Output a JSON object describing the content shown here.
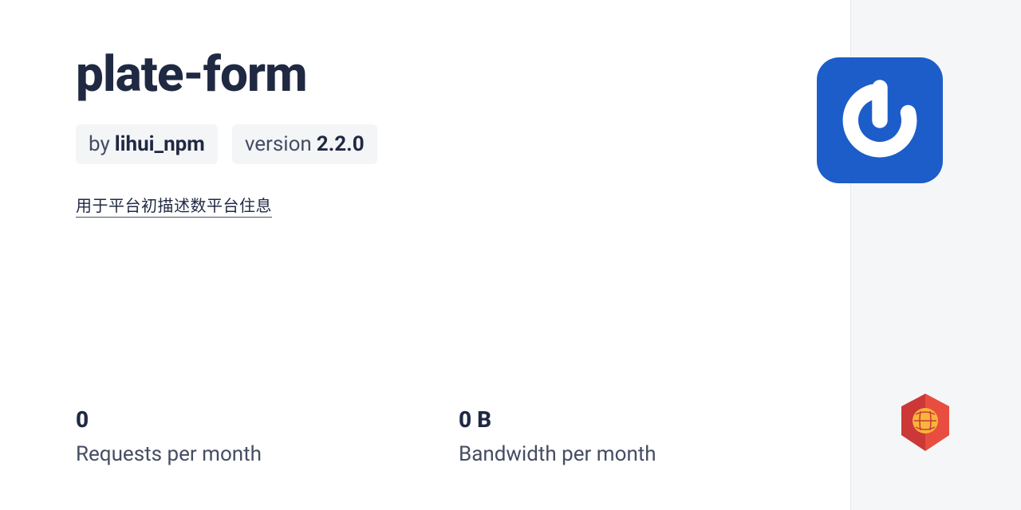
{
  "package": {
    "name": "plate-form",
    "author_prefix": "by ",
    "author": "lihui_npm",
    "version_label": "version ",
    "version": "2.2.0",
    "description": "用于平台初描述数平台住息"
  },
  "stats": {
    "requests": {
      "value": "0",
      "label": "Requests per month"
    },
    "bandwidth": {
      "value": "0 B",
      "label": "Bandwidth per month"
    }
  }
}
